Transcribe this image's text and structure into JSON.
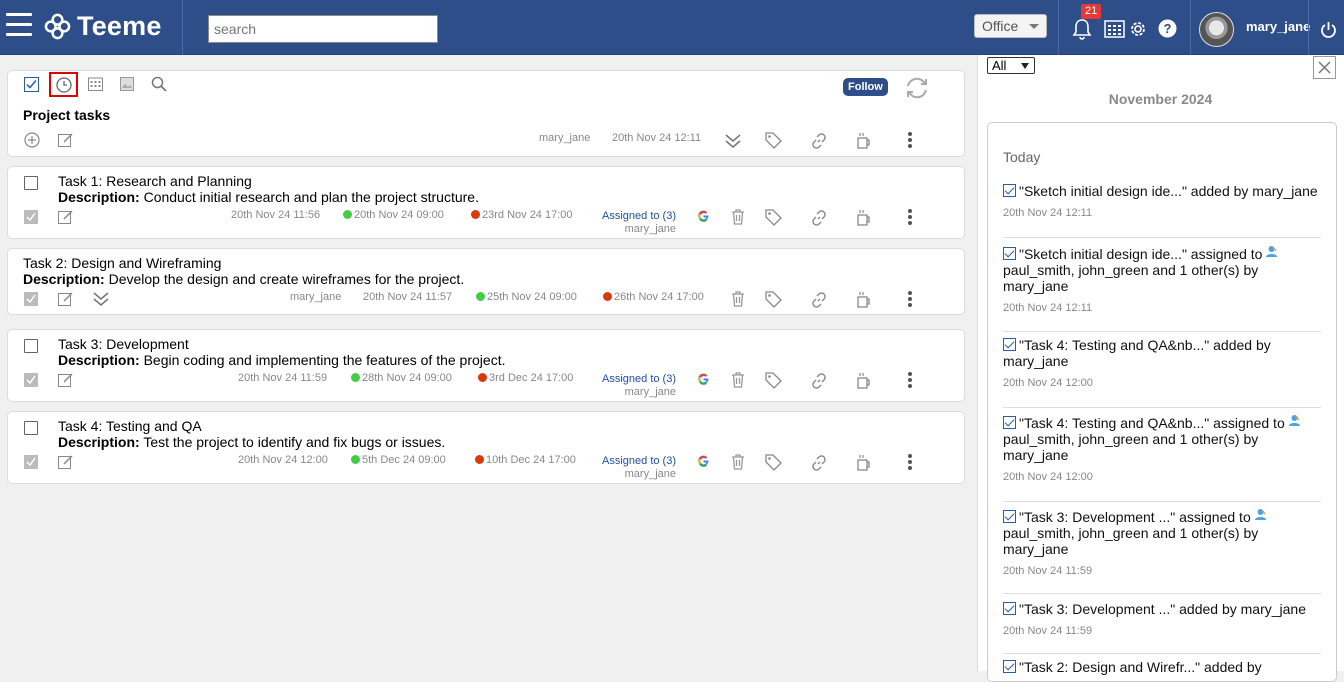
{
  "app": {
    "name": "Teeme",
    "search_placeholder": "search",
    "office_label": "Office",
    "notification_count": "21",
    "user": "mary_jane"
  },
  "colors": {
    "topbar": "#2e4e8a",
    "link_blue": "#1f4fa8",
    "start_dot": "#44cc44",
    "due_dot": "#d83a0c",
    "badge": "#e53935"
  },
  "project": {
    "title": "Project tasks",
    "user": "mary_jane",
    "date": "20th Nov 24 12:11",
    "follow_label": "Follow"
  },
  "tasks": [
    {
      "title": "Task 1: Research and Planning",
      "desc_label": "Description:",
      "desc": " Conduct initial research and plan the project structure.",
      "created": "20th Nov 24 11:56",
      "start": "20th Nov 24 09:00",
      "due": "23rd Nov 24 17:00",
      "assigned": "Assigned to (3)",
      "by": "mary_jane"
    },
    {
      "title": "Task 2: Design and Wireframing",
      "desc_label": "Description:",
      "desc": " Develop the design and create wireframes for the project.",
      "user": "mary_jane",
      "created": "20th Nov 24 11:57",
      "start": "25th Nov 24 09:00",
      "due": "26th Nov 24 17:00"
    },
    {
      "title": "Task 3: Development",
      "desc_label": "Description:",
      "desc": " Begin coding and implementing the features of the project.",
      "created": "20th Nov 24 11:59",
      "start": "28th Nov 24 09:00",
      "due": "3rd Dec 24 17:00",
      "assigned": "Assigned to (3)",
      "by": "mary_jane"
    },
    {
      "title": "Task 4: Testing and QA",
      "desc_label": "Description:",
      "desc": " Test the project to identify and fix bugs or issues.",
      "created": "20th Nov 24 12:00",
      "start": "5th Dec 24 09:00",
      "due": "10th Dec 24 17:00",
      "assigned": "Assigned to (3)",
      "by": "mary_jane"
    }
  ],
  "panel": {
    "filter": "All",
    "month": "November 2024",
    "today_label": "Today",
    "feed": [
      {
        "text": "\"Sketch initial design ide...\" added by mary_jane",
        "time": "20th Nov 24 12:11"
      },
      {
        "text_a": "\"Sketch initial design ide...\" assigned to",
        "text_b": "paul_smith, john_green and 1 other(s) by mary_jane",
        "time": "20th Nov 24 12:11"
      },
      {
        "text": "\"Task 4: Testing and QA&nb...\" added by mary_jane",
        "time": "20th Nov 24 12:00"
      },
      {
        "text_a": "\"Task 4: Testing and QA&nb...\" assigned to",
        "text_b": "paul_smith, john_green and 1 other(s) by mary_jane",
        "time": "20th Nov 24 12:00"
      },
      {
        "text_a": "\"Task 3: Development ...\" assigned to",
        "text_b": "paul_smith, john_green and 1 other(s) by mary_jane",
        "time": "20th Nov 24 11:59"
      },
      {
        "text": "\"Task 3: Development ...\" added by mary_jane",
        "time": "20th Nov 24 11:59"
      },
      {
        "text": "\"Task 2: Design and Wirefr...\" added by"
      }
    ]
  }
}
